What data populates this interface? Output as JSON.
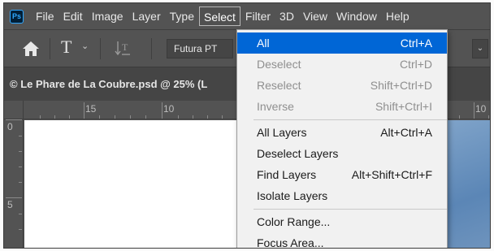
{
  "app": {
    "logo_text": "Ps"
  },
  "menubar": {
    "items": [
      {
        "label": "File"
      },
      {
        "label": "Edit"
      },
      {
        "label": "Image"
      },
      {
        "label": "Layer"
      },
      {
        "label": "Type"
      },
      {
        "label": "Select"
      },
      {
        "label": "Filter"
      },
      {
        "label": "3D"
      },
      {
        "label": "View"
      },
      {
        "label": "Window"
      },
      {
        "label": "Help"
      }
    ],
    "active": "Select"
  },
  "options_bar": {
    "home_icon": "home-icon",
    "tool_glyph": "T",
    "tool_chevron": "⌄",
    "orientation_icon": "toggle-text-orientation-icon",
    "font_family": "Futura PT",
    "right_dropdown_glyph": "⌄"
  },
  "document_tab": {
    "title": "© Le Phare de La Coubre.psd @ 25% (L"
  },
  "rulers": {
    "top_labels": [
      "15",
      "10",
      "10"
    ],
    "left_labels": [
      "0",
      "5"
    ]
  },
  "select_menu": {
    "groups": [
      [
        {
          "label": "All",
          "shortcut": "Ctrl+A",
          "highlighted": true,
          "enabled": true
        },
        {
          "label": "Deselect",
          "shortcut": "Ctrl+D",
          "enabled": false
        },
        {
          "label": "Reselect",
          "shortcut": "Shift+Ctrl+D",
          "enabled": false
        },
        {
          "label": "Inverse",
          "shortcut": "Shift+Ctrl+I",
          "enabled": false
        }
      ],
      [
        {
          "label": "All Layers",
          "shortcut": "Alt+Ctrl+A",
          "enabled": true
        },
        {
          "label": "Deselect Layers",
          "shortcut": "",
          "enabled": true
        },
        {
          "label": "Find Layers",
          "shortcut": "Alt+Shift+Ctrl+F",
          "enabled": true
        },
        {
          "label": "Isolate Layers",
          "shortcut": "",
          "enabled": true
        }
      ],
      [
        {
          "label": "Color Range...",
          "shortcut": "",
          "enabled": true
        },
        {
          "label": "Focus Area...",
          "shortcut": "",
          "enabled": true
        }
      ]
    ]
  },
  "colors": {
    "menu_highlight": "#0066d6",
    "ui_background": "#535353",
    "menu_background": "#f1f1f1",
    "ps_brand": "#31a8ff"
  }
}
